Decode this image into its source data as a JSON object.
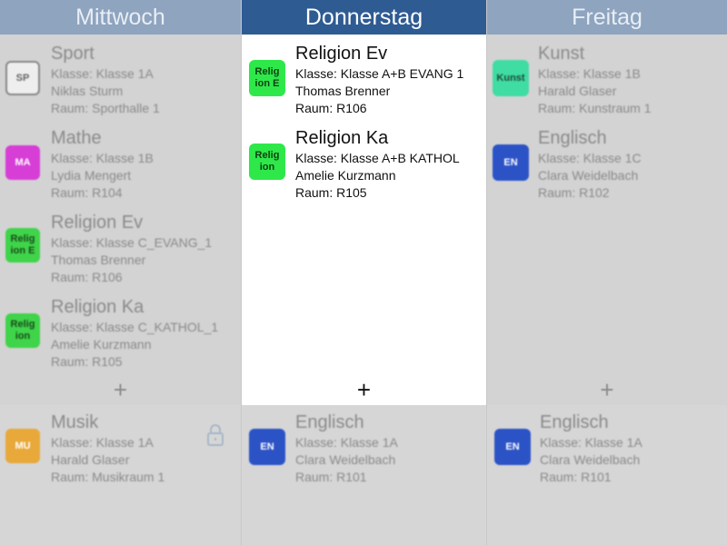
{
  "days": [
    {
      "name": "Mittwoch",
      "entries": [
        {
          "subject": "Sport",
          "klasse": "Klasse: Klasse 1A",
          "teacher": "Niklas Sturm",
          "room": "Raum: Sporthalle 1",
          "badge": "SP",
          "badge_color": "#eeeeee",
          "badge_text_color": "#666666"
        },
        {
          "subject": "Mathe",
          "klasse": "Klasse: Klasse 1B",
          "teacher": "Lydia Mengert",
          "room": "Raum: R104",
          "badge": "MA",
          "badge_color": "#d63ed6",
          "badge_text_color": "#ffffff"
        },
        {
          "subject": "Religion Ev",
          "klasse": "Klasse: Klasse C_EVANG_1",
          "teacher": "Thomas Brenner",
          "room": "Raum: R106",
          "badge": "Relig ion E",
          "badge_color": "#3fd44a",
          "badge_text_color": "#1a4a1a"
        },
        {
          "subject": "Religion Ka",
          "klasse": "Klasse: Klasse C_KATHOL_1",
          "teacher": "Amelie Kurzmann",
          "room": "Raum: R105",
          "badge": "Relig ion",
          "badge_color": "#3fd44a",
          "badge_text_color": "#1a4a1a"
        }
      ],
      "add": "+",
      "bottom": {
        "subject": "Musik",
        "klasse": "Klasse: Klasse 1A",
        "teacher": "Harald Glaser",
        "room": "Raum: Musikraum 1",
        "badge": "MU",
        "badge_color": "#e8a93a",
        "badge_text_color": "#ffffff"
      }
    },
    {
      "name": "Donnerstag",
      "entries": [
        {
          "subject": "Religion Ev",
          "klasse": "Klasse: Klasse A+B EVANG 1",
          "teacher": "Thomas Brenner",
          "room": "Raum: R106",
          "badge": "Relig ion E",
          "badge_color": "#2ee84a",
          "badge_text_color": "#0f3f12"
        },
        {
          "subject": "Religion Ka",
          "klasse": "Klasse: Klasse A+B KATHOL",
          "teacher": "Amelie Kurzmann",
          "room": "Raum: R105",
          "badge": "Relig ion",
          "badge_color": "#2ee84a",
          "badge_text_color": "#0f3f12"
        }
      ],
      "add": "+",
      "bottom": {
        "subject": "Englisch",
        "klasse": "Klasse: Klasse 1A",
        "teacher": "Clara Weidelbach",
        "room": "Raum: R101",
        "badge": "EN",
        "badge_color": "#2c53c6",
        "badge_text_color": "#ffffff"
      }
    },
    {
      "name": "Freitag",
      "entries": [
        {
          "subject": "Kunst",
          "klasse": "Klasse: Klasse 1B",
          "teacher": "Harald Glaser",
          "room": "Raum: Kunstraum 1",
          "badge": "Kunst",
          "badge_color": "#3fdca3",
          "badge_text_color": "#1d4a3a"
        },
        {
          "subject": "Englisch",
          "klasse": "Klasse: Klasse 1C",
          "teacher": "Clara Weidelbach",
          "room": "Raum: R102",
          "badge": "EN",
          "badge_color": "#2c53c6",
          "badge_text_color": "#ffffff"
        }
      ],
      "add": "+",
      "bottom": {
        "subject": "Englisch",
        "klasse": "Klasse: Klasse 1A",
        "teacher": "Clara Weidelbach",
        "room": "Raum: R101",
        "badge": "EN",
        "badge_color": "#2c53c6",
        "badge_text_color": "#ffffff"
      }
    }
  ]
}
